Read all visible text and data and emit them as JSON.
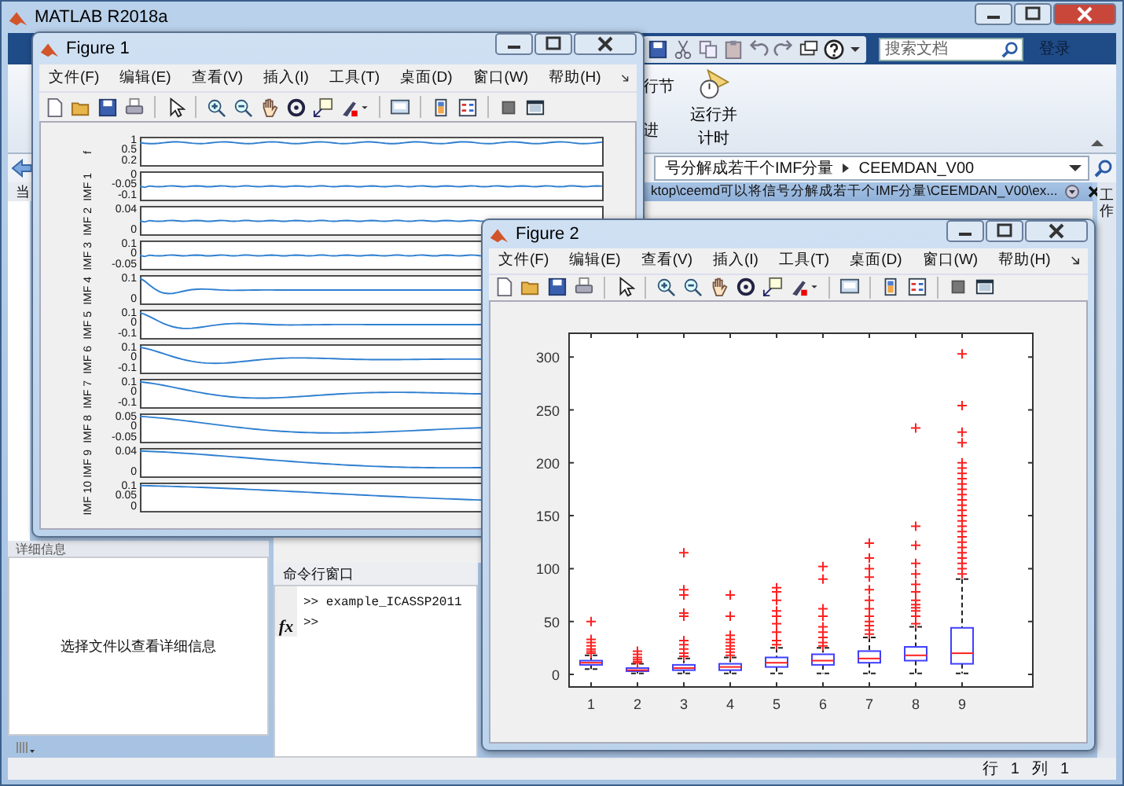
{
  "main_window": {
    "title": "MATLAB R2018a"
  },
  "search": {
    "placeholder": "搜索文档"
  },
  "login": "登录",
  "ribbon": {
    "partial_labels": [
      "行节",
      "进"
    ],
    "run_time_button": [
      "运行并",
      "计时"
    ]
  },
  "address_bar": {
    "path": "号分解成若干个IMF分量",
    "folder": "CEEMDAN_V00"
  },
  "current_folder": {
    "header_left": "当",
    "path": "ktop\\ceemd可以将信号分解成若干个IMF分量\\CEEMDAN_V00\\ex..."
  },
  "workspace_tab": "工作",
  "details_panel": {
    "title": "详细信息",
    "message": "选择文件以查看详细信息"
  },
  "command_window": {
    "title": "命令行窗口",
    "fx_label": "fx",
    "history": [
      ">> example_ICASSP2011"
    ],
    "prompt": ">>"
  },
  "status_bar": {
    "row_label": "行",
    "row": "1",
    "col_label": "列",
    "col": "1"
  },
  "figure1": {
    "title": "Figure 1",
    "menu": [
      "文件(F)",
      "编辑(E)",
      "查看(V)",
      "插入(I)",
      "工具(T)",
      "桌面(D)",
      "窗口(W)",
      "帮助(H)"
    ],
    "subplots": [
      {
        "ylabel": "f",
        "yticks": [
          "1",
          "0.5",
          "0.2"
        ]
      },
      {
        "ylabel": "IMF 1",
        "yticks": [
          "0",
          "-0.05",
          "-0.1"
        ]
      },
      {
        "ylabel": "IMF 2",
        "yticks": [
          "0.04",
          "0"
        ]
      },
      {
        "ylabel": "IMF 3",
        "yticks": [
          "0.1",
          "0",
          "-0.05"
        ]
      },
      {
        "ylabel": "IMF 4",
        "yticks": [
          "0.1",
          "0"
        ]
      },
      {
        "ylabel": "IMF 5",
        "yticks": [
          "0.1",
          "0",
          "-0.1"
        ]
      },
      {
        "ylabel": "IMF 6",
        "yticks": [
          "0.1",
          "0",
          "-0.1"
        ]
      },
      {
        "ylabel": "IMF 7",
        "yticks": [
          "0.1",
          "0",
          "-0.1"
        ]
      },
      {
        "ylabel": "IMF 8",
        "yticks": [
          "0.05",
          "0",
          "-0.05"
        ]
      },
      {
        "ylabel": "IMF 9",
        "yticks": [
          "0.04",
          "0"
        ]
      },
      {
        "ylabel": "IMF 10",
        "yticks": [
          "0.1",
          "0.05",
          "0"
        ]
      }
    ]
  },
  "figure2": {
    "title": "Figure 2",
    "menu": [
      "文件(F)",
      "编辑(E)",
      "查看(V)",
      "插入(I)",
      "工具(T)",
      "桌面(D)",
      "窗口(W)",
      "帮助(H)"
    ],
    "yticks": [
      "300",
      "250",
      "200",
      "150",
      "100",
      "50",
      "0"
    ],
    "xticks": [
      "1",
      "2",
      "3",
      "4",
      "5",
      "6",
      "7",
      "8",
      "9"
    ]
  }
}
